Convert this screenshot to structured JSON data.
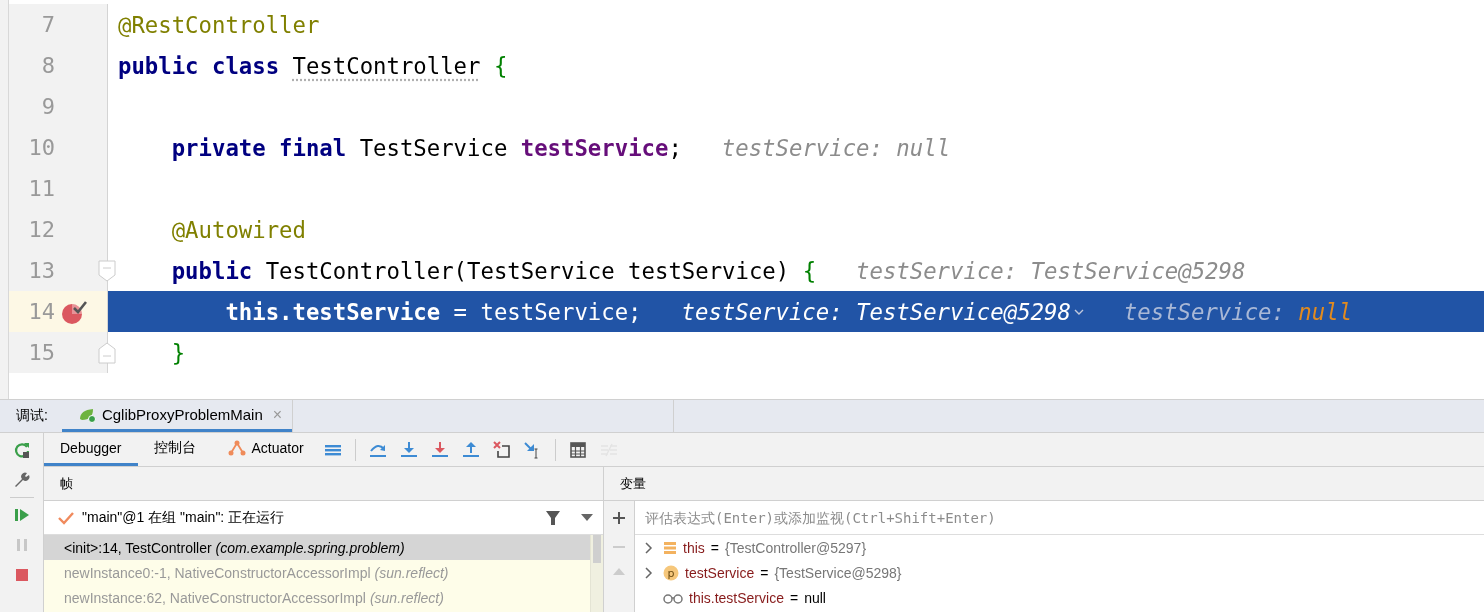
{
  "editor": {
    "lines": [
      {
        "number": "7",
        "breakpoint": false,
        "current": false,
        "fold_start": false,
        "fold_end": false,
        "tokens": [
          {
            "kind": "annotation",
            "text": "@RestController"
          }
        ]
      },
      {
        "number": "8",
        "breakpoint": false,
        "current": false,
        "fold_start": false,
        "fold_end": false,
        "tokens": [
          {
            "kind": "keyword",
            "text": "public class "
          },
          {
            "kind": "class-name",
            "text": "TestController"
          },
          {
            "kind": "brace",
            "text": " {"
          }
        ]
      },
      {
        "number": "9",
        "breakpoint": false,
        "current": false,
        "fold_start": false,
        "fold_end": false
      },
      {
        "number": "10",
        "breakpoint": false,
        "current": false,
        "fold_start": false,
        "fold_end": false,
        "tokens": [
          {
            "kind": "keyword",
            "text": "    private final "
          },
          {
            "kind": "plain",
            "text": "TestService "
          },
          {
            "kind": "field",
            "text": "testService"
          },
          {
            "kind": "plain",
            "text": ";"
          },
          {
            "kind": "hint",
            "text": "testService: null",
            "dropdown": false
          }
        ]
      },
      {
        "number": "11",
        "breakpoint": false,
        "current": false,
        "fold_start": false,
        "fold_end": false
      },
      {
        "number": "12",
        "breakpoint": false,
        "current": false,
        "fold_start": false,
        "fold_end": false,
        "tokens": [
          {
            "kind": "annotation",
            "text": "    @Autowired"
          }
        ]
      },
      {
        "number": "13",
        "breakpoint": false,
        "current": false,
        "fold_start": true,
        "fold_end": false,
        "tokens": [
          {
            "kind": "keyword",
            "text": "    public "
          },
          {
            "kind": "plain",
            "text": "TestController(TestService testService) "
          },
          {
            "kind": "brace",
            "text": "{"
          },
          {
            "kind": "hint",
            "text": "testService: TestService@5298",
            "dropdown": false
          }
        ]
      },
      {
        "number": "14",
        "breakpoint": true,
        "current": true,
        "fold_start": false,
        "fold_end": false,
        "tokens": [
          {
            "kind": "keyword",
            "text": "        this"
          },
          {
            "kind": "field",
            "text": ".testService"
          },
          {
            "kind": "plain",
            "text": " = testService;"
          },
          {
            "kind": "hint",
            "text": "testService: TestService@5298",
            "dropdown": true
          },
          {
            "kind": "hint-label",
            "text": "testService: "
          },
          {
            "kind": "null-value",
            "text": "null"
          }
        ]
      },
      {
        "number": "15",
        "breakpoint": false,
        "current": false,
        "fold_start": false,
        "fold_end": true,
        "tokens": [
          {
            "kind": "brace",
            "text": "    }"
          }
        ]
      }
    ]
  },
  "debug_panel": {
    "title": "调试:",
    "session_tab": {
      "label": "CglibProxyProblemMain",
      "close": "×",
      "selected": true
    },
    "side_actions": [
      {
        "kind": "rerun",
        "disabled": false
      },
      {
        "kind": "settings",
        "disabled": false
      },
      {
        "kind": "resume",
        "disabled": false
      },
      {
        "kind": "pause",
        "disabled": true
      },
      {
        "kind": "stop",
        "disabled": false
      }
    ],
    "tabs": [
      {
        "label": "Debugger",
        "kind": "plain",
        "selected": true
      },
      {
        "label": "控制台",
        "kind": "plain",
        "selected": false
      },
      {
        "label": "Actuator",
        "kind": "actuator",
        "selected": false
      }
    ],
    "actions": [
      {
        "kind": "menu",
        "disabled": false
      },
      {
        "kind": "step-over",
        "disabled": false
      },
      {
        "kind": "step-into",
        "disabled": false
      },
      {
        "kind": "force-step-into",
        "disabled": false
      },
      {
        "kind": "step-out",
        "disabled": false
      },
      {
        "kind": "drop-frame",
        "disabled": false
      },
      {
        "kind": "run-to-cursor",
        "disabled": false
      },
      {
        "kind": "evaluate",
        "disabled": false
      },
      {
        "kind": "trace",
        "disabled": true
      }
    ],
    "frames": {
      "header": "帧",
      "thread": "\"main\"@1 在组 \"main\": 正在运行",
      "items": [
        {
          "method": "<init>:14, TestController",
          "package": "(com.example.spring.problem)",
          "selected": true
        },
        {
          "method": "newInstance0:-1, NativeConstructorAccessorImpl",
          "package": "(sun.reflect)",
          "selected": false
        },
        {
          "method": "newInstance:62, NativeConstructorAccessorImpl",
          "package": "(sun.reflect)",
          "selected": false
        }
      ]
    },
    "variables": {
      "header": "变量",
      "eval_placeholder": "评估表达式(Enter)或添加监视(Ctrl+Shift+Enter)",
      "items": [
        {
          "kind": "object",
          "name": "this",
          "separator": "=",
          "value": "{TestController@5297}",
          "expandable": true
        },
        {
          "kind": "field",
          "badge": "p",
          "name": "testService",
          "separator": "=",
          "value": "{TestService@5298}",
          "expandable": true
        },
        {
          "kind": "watch",
          "name": "this.testService",
          "separator": "=",
          "value": "null",
          "expandable": false
        }
      ]
    }
  }
}
